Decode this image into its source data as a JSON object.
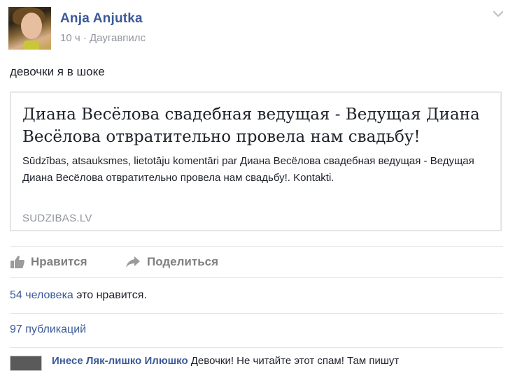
{
  "post": {
    "author": "Anja Anjutka",
    "time": "10 ч",
    "separator": "·",
    "location": "Даугавпилс",
    "text": "девочки я в шоке"
  },
  "link_card": {
    "title": "Диана Весёлова свадебная ведущая - Ведущая Диана Весёлова отвратительно провела нам свадьбу!",
    "description": "Sūdzības, atsauksmes, lietotāju komentāri par Диана Весёлова свадебная ведущая - Ведущая Диана Весёлова отвратительно провела нам свадьбу!. Kontakti.",
    "domain": "SUDZIBAS.LV"
  },
  "actions": {
    "like_label": "Нравится",
    "share_label": "Поделиться",
    "like_icon": "thumbs-up-icon",
    "share_icon": "share-arrow-icon"
  },
  "stats": {
    "likes_link": "54 человека",
    "likes_suffix": " это нравится.",
    "shares": "97 публикаций"
  },
  "comment_preview": {
    "author": "Инесе Ляк-лишко Илюшко",
    "text": " Девочки! Не читайте этот спам! Там пишут"
  },
  "colors": {
    "link_blue": "#3b5998",
    "meta_grey": "#90949c",
    "action_grey": "#7f7f7f",
    "border": "#dddfe2"
  }
}
